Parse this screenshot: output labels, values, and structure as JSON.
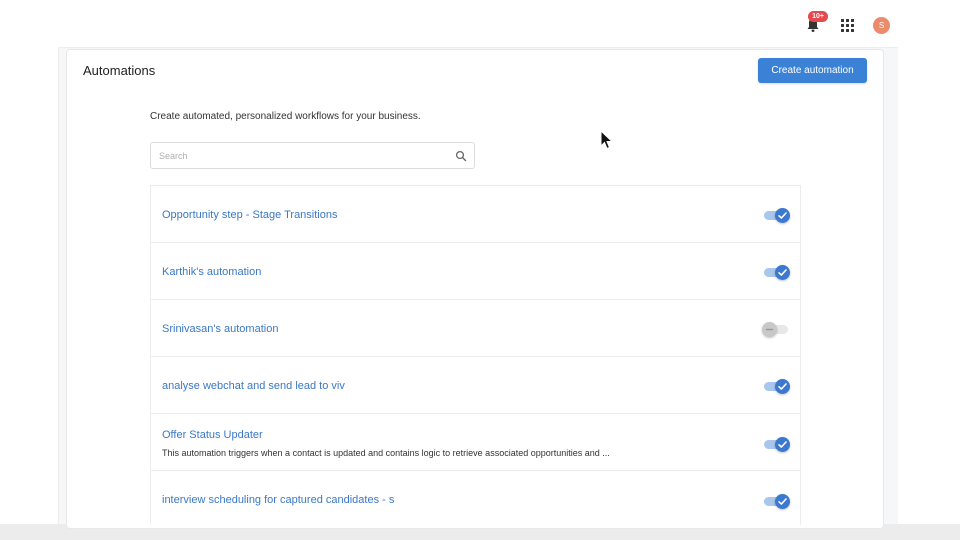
{
  "header": {
    "notification_badge": "10+",
    "avatar_initial": "S"
  },
  "page": {
    "title": "Automations",
    "create_button_label": "Create automation",
    "description": "Create automated, personalized workflows for your business.",
    "search_placeholder": "Search"
  },
  "automations": [
    {
      "title": "Opportunity step - Stage Transitions",
      "description": "",
      "enabled": true
    },
    {
      "title": "Karthik's automation",
      "description": "",
      "enabled": true
    },
    {
      "title": "Srinivasan's automation",
      "description": "",
      "enabled": false
    },
    {
      "title": "analyse webchat and send lead to viv",
      "description": "",
      "enabled": true
    },
    {
      "title": "Offer Status Updater",
      "description": "This automation triggers when a contact is updated and contains logic to retrieve associated opportunities and ...",
      "enabled": true
    },
    {
      "title": "interview scheduling for captured candidates - s",
      "description": "",
      "enabled": true
    }
  ],
  "colors": {
    "accent": "#3b82d6",
    "link": "#3b78c4",
    "toggle_on": "#3b78d0",
    "toggle_off": "#c8c8c8",
    "badge": "#e5484d",
    "avatar": "#ee8a6c"
  },
  "icons": {
    "notifications": "bell-icon",
    "apps": "grid-icon",
    "search": "search-icon",
    "toggle_check": "check-icon"
  }
}
